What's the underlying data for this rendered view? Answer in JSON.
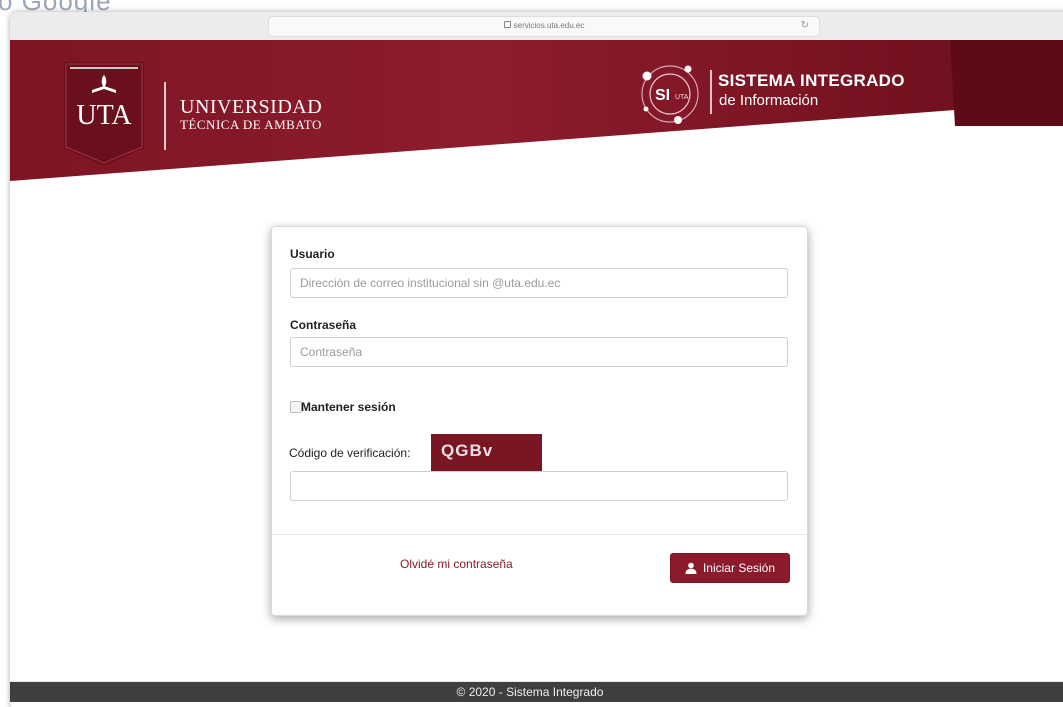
{
  "behind_text": "o Google",
  "browser": {
    "url": "servicios.uta.edu.ec"
  },
  "header": {
    "uta_logo_text": "UTA",
    "university_line1": "UNIVERSIDAD",
    "university_line2": "TÉCNICA DE AMBATO",
    "si_logo_text": "SI",
    "si_logo_sub": "UTA",
    "system_title": "SISTEMA INTEGRADO",
    "system_subtitle": "de Información"
  },
  "login": {
    "user_label": "Usuario",
    "user_placeholder": "Dirección de correo institucional sin @uta.edu.ec",
    "user_value": "",
    "password_label": "Contraseña",
    "password_placeholder": "Contraseña",
    "password_value": "",
    "remember_label": "Mantener sesión",
    "remember_checked": false,
    "captcha_label": "Código de verificación:",
    "captcha_code": "QGBv",
    "captcha_value": "",
    "forgot_link": "Olvidé mi contraseña",
    "submit_label": "Iniciar Sesión"
  },
  "footer": {
    "text": "© 2020 - Sistema Integrado"
  },
  "colors": {
    "brand_maroon": "#8b1a2b",
    "header_dark": "#6d0f1d",
    "footer_bg": "#3f3f3f"
  },
  "icons": {
    "lock": "lock-icon",
    "reload": "reload-icon",
    "user": "user-icon"
  }
}
